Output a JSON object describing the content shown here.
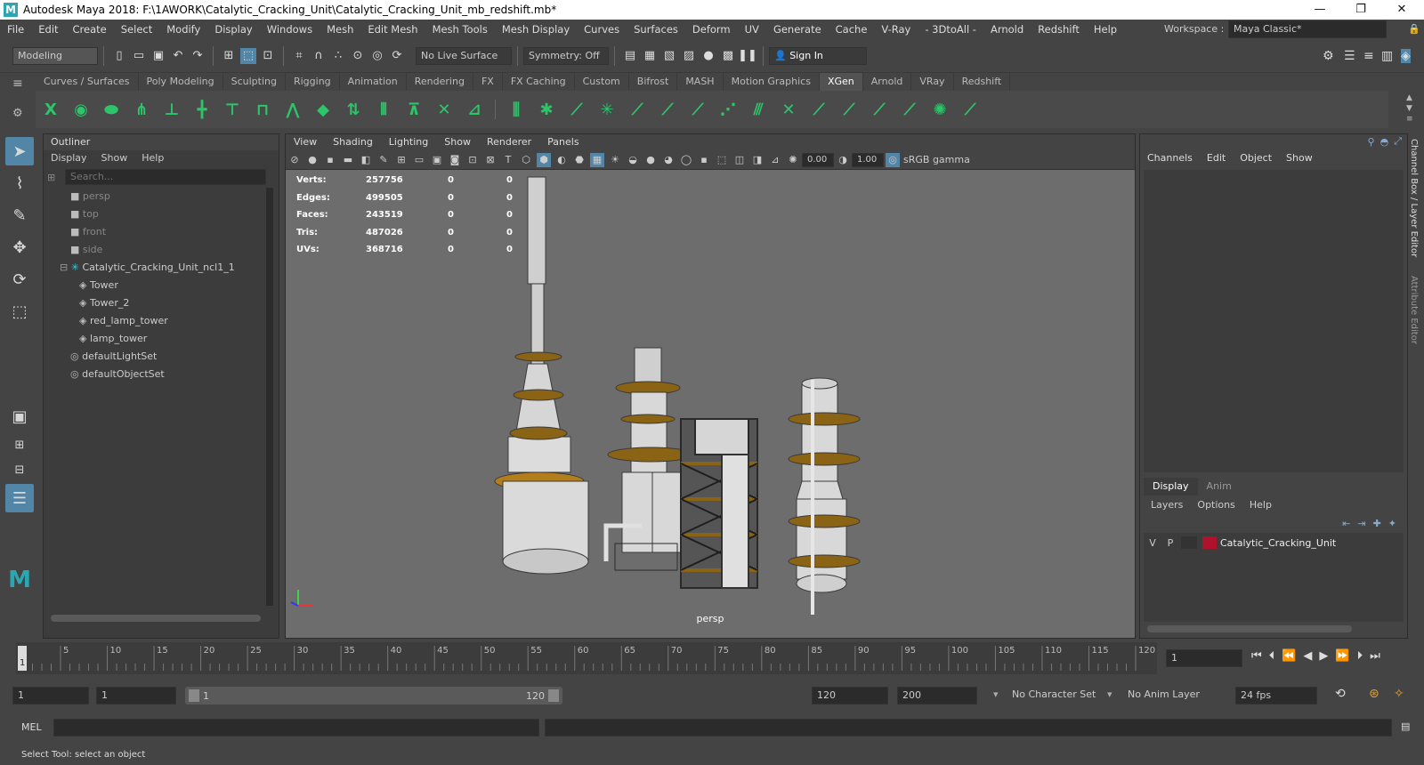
{
  "window": {
    "title": "Autodesk Maya 2018: F:\\1AWORK\\Catalytic_Cracking_Unit\\Catalytic_Cracking_Unit_mb_redshift.mb*",
    "logo_letter": "M",
    "minimize": "—",
    "restore": "❐",
    "close": "✕"
  },
  "menubar": {
    "items": [
      "File",
      "Edit",
      "Create",
      "Select",
      "Modify",
      "Display",
      "Windows",
      "Mesh",
      "Edit Mesh",
      "Mesh Tools",
      "Mesh Display",
      "Curves",
      "Surfaces",
      "Deform",
      "UV",
      "Generate",
      "Cache",
      "V-Ray",
      "- 3DtoAll -",
      "Arnold",
      "Redshift",
      "Help"
    ],
    "workspace_label": "Workspace :",
    "workspace_value": "Maya Classic*"
  },
  "statusline": {
    "mode": "Modeling",
    "live_surface": "No Live Surface",
    "symmetry": "Symmetry: Off",
    "sign_in": "Sign In"
  },
  "shelf": {
    "tabs": [
      "Curves / Surfaces",
      "Poly Modeling",
      "Sculpting",
      "Rigging",
      "Animation",
      "Rendering",
      "FX",
      "FX Caching",
      "Custom",
      "Bifrost",
      "MASH",
      "Motion Graphics",
      "XGen",
      "Arnold",
      "VRay",
      "Redshift"
    ],
    "active_tab": "XGen",
    "accent": "#2ec46a"
  },
  "outliner": {
    "title": "Outliner",
    "menu": [
      "Display",
      "Show",
      "Help"
    ],
    "search_placeholder": "Search...",
    "items": [
      {
        "label": "persp",
        "dim": true
      },
      {
        "label": "top",
        "dim": true
      },
      {
        "label": "front",
        "dim": true
      },
      {
        "label": "side",
        "dim": true
      },
      {
        "label": "Catalytic_Cracking_Unit_ncl1_1",
        "dim": false
      },
      {
        "label": "Tower",
        "dim": false
      },
      {
        "label": "Tower_2",
        "dim": false
      },
      {
        "label": "red_lamp_tower",
        "dim": false
      },
      {
        "label": "lamp_tower",
        "dim": false
      },
      {
        "label": "defaultLightSet",
        "dim": false
      },
      {
        "label": "defaultObjectSet",
        "dim": false
      }
    ]
  },
  "viewport": {
    "menu": [
      "View",
      "Shading",
      "Lighting",
      "Show",
      "Renderer",
      "Panels"
    ],
    "exposure": "0.00",
    "gamma": "1.00",
    "color_space": "sRGB gamma",
    "camera_label": "persp",
    "stats": [
      {
        "label": "Verts:",
        "value": "257756",
        "a": "0",
        "b": "0"
      },
      {
        "label": "Edges:",
        "value": "499505",
        "a": "0",
        "b": "0"
      },
      {
        "label": "Faces:",
        "value": "243519",
        "a": "0",
        "b": "0"
      },
      {
        "label": "Tris:",
        "value": "487026",
        "a": "0",
        "b": "0"
      },
      {
        "label": "UVs:",
        "value": "368716",
        "a": "0",
        "b": "0"
      }
    ]
  },
  "channelbox": {
    "menu": [
      "Channels",
      "Edit",
      "Object",
      "Show"
    ],
    "layer_tabs": [
      "Display",
      "Anim"
    ],
    "layer_menu": [
      "Layers",
      "Options",
      "Help"
    ],
    "layer": {
      "v": "V",
      "p": "P",
      "name": "Catalytic_Cracking_Unit",
      "color": "#b0122b"
    },
    "side_tabs": [
      "Channel Box / Layer Editor",
      "Attribute Editor"
    ]
  },
  "timeline": {
    "ticks": [
      "5",
      "10",
      "15",
      "20",
      "25",
      "30",
      "35",
      "40",
      "45",
      "50",
      "55",
      "60",
      "65",
      "70",
      "75",
      "80",
      "85",
      "90",
      "95",
      "100",
      "105",
      "110",
      "115",
      "120"
    ],
    "start_marker": "1",
    "current_frame": "1"
  },
  "range": {
    "start": "1",
    "playback_start": "1",
    "slider_start": "1",
    "slider_end": "120",
    "playback_end": "120",
    "end": "200",
    "character_set": "No Character Set",
    "anim_layer": "No Anim Layer",
    "fps": "24 fps"
  },
  "cmdline": {
    "label": "MEL"
  },
  "helpline": {
    "text": "Select Tool: select an object"
  }
}
